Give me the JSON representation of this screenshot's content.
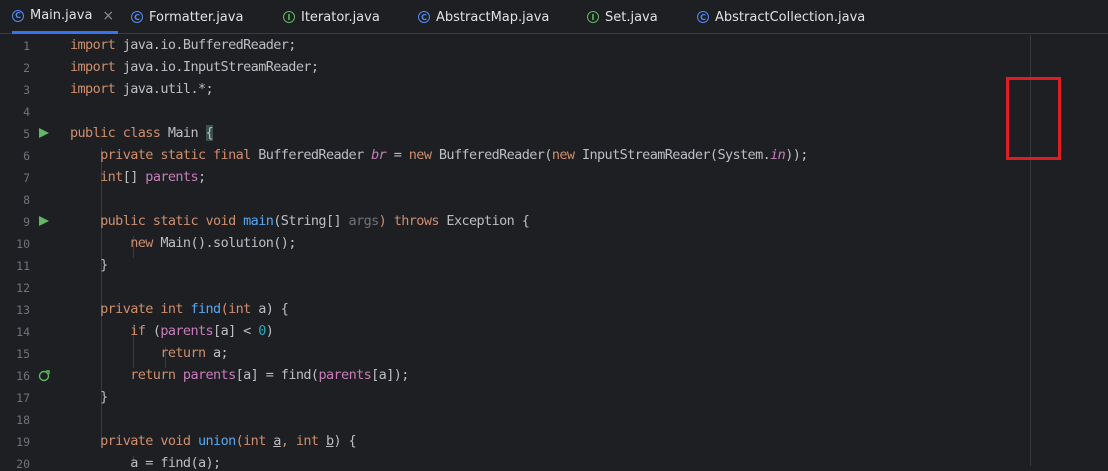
{
  "tabs": [
    {
      "label": "Main.java",
      "icon": "class-icon",
      "active": true,
      "closable": true
    },
    {
      "label": "Formatter.java",
      "icon": "class-icon"
    },
    {
      "label": "Iterator.java",
      "icon": "interface-icon"
    },
    {
      "label": "AbstractMap.java",
      "icon": "class-icon"
    },
    {
      "label": "Set.java",
      "icon": "interface-icon"
    },
    {
      "label": "AbstractCollection.java",
      "icon": "class-icon"
    }
  ],
  "line_numbers": [
    "1",
    "2",
    "3",
    "4",
    "5",
    "6",
    "7",
    "8",
    "9",
    "10",
    "11",
    "12",
    "13",
    "14",
    "15",
    "16",
    "17",
    "18",
    "19",
    "20"
  ],
  "code": {
    "l1_kw": "import",
    "l1_rest": " java.io.BufferedReader;",
    "l2_kw": "import",
    "l2_rest": " java.io.InputStreamReader;",
    "l3_kw": "import",
    "l3_rest": " java.util.*;",
    "l5_kw": "public class ",
    "l5_name": "Main ",
    "l5_brace": "{",
    "l6_kw": "    private static final ",
    "l6_type": "BufferedReader ",
    "l6_var": "br",
    "l6_eq": " = ",
    "l6_new": "new ",
    "l6_ctor": "BufferedReader(",
    "l6_new2": "new ",
    "l6_ctor2": "InputStreamReader(System.",
    "l6_in": "in",
    "l6_end": "));",
    "l7_type": "    int",
    "l7_arr": "[] ",
    "l7_field": "parents",
    "l7_end": ";",
    "l9_kw": "    public static void ",
    "l9_fn": "main",
    "l9_args": "(String[] ",
    "l9_param": "args",
    "l9_throws": ") throws ",
    "l9_exc": "Exception {",
    "l10_new": "        new ",
    "l10_rest": "Main().solution();",
    "l11_brace": "    }",
    "l13_kw": "    private int ",
    "l13_fn": "find",
    "l13_args": "(int ",
    "l13_param": "a",
    "l13_end": ") {",
    "l14_if": "        if ",
    "l14_open": "(",
    "l14_field": "parents",
    "l14_idx": "[a] < ",
    "l14_num": "0",
    "l14_close": ")",
    "l15_ret": "            return ",
    "l15_rest": "a;",
    "l16_ret": "        return ",
    "l16_field": "parents",
    "l16_idx": "[a] = ",
    "l16_fn": "find",
    "l16_open": "(",
    "l16_field2": "parents",
    "l16_end": "[a]);",
    "l17_brace": "    }",
    "l19_kw": "    private void ",
    "l19_fn": "union",
    "l19_args": "(int ",
    "l19_p1": "a",
    "l19_mid": ", int ",
    "l19_p2": "b",
    "l19_end": ") {",
    "l20_rest": "        a = find(a);"
  }
}
